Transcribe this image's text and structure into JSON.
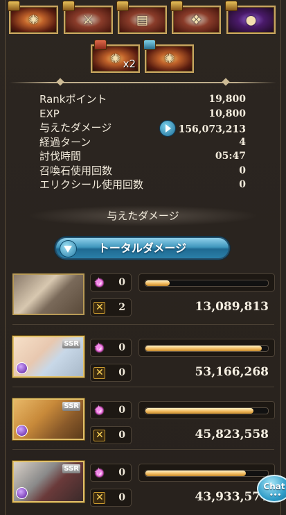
{
  "drops": {
    "row1": [
      {
        "icon": "scroll-icon",
        "count": ""
      },
      {
        "icon": "sword-icon",
        "count": ""
      },
      {
        "icon": "document-icon",
        "count": ""
      },
      {
        "icon": "map-icon",
        "count": ""
      },
      {
        "icon": "orb-icon",
        "count": ""
      }
    ],
    "row2": [
      {
        "icon": "scroll-icon",
        "count": "x2"
      },
      {
        "icon": "scroll-icon",
        "count": ""
      }
    ]
  },
  "stats": {
    "rank_label": "Rankポイント",
    "rank_value": "19,800",
    "exp_label": "EXP",
    "exp_value": "10,800",
    "damage_label": "与えたダメージ",
    "damage_value": "156,073,213",
    "turns_label": "経過ターン",
    "turns_value": "4",
    "time_label": "討伐時間",
    "time_value": "05:47",
    "summon_label": "召喚石使用回数",
    "summon_value": "0",
    "elixir_label": "エリクシール使用回数",
    "elixir_value": "0"
  },
  "section_title": "与えたダメージ",
  "tab_label": "トータルダメージ",
  "members": [
    {
      "ssr": "",
      "ougi": "0",
      "ca": "2",
      "damage": "13,089,813",
      "bar": 0.2
    },
    {
      "ssr": "SSR",
      "ougi": "0",
      "ca": "0",
      "damage": "53,166,268",
      "bar": 0.95
    },
    {
      "ssr": "SSR",
      "ougi": "0",
      "ca": "0",
      "damage": "45,823,558",
      "bar": 0.88
    },
    {
      "ssr": "SSR",
      "ougi": "0",
      "ca": "0",
      "damage": "43,933,574",
      "bar": 0.82
    }
  ],
  "chat_label": "Chat",
  "colors": {
    "accent": "#3f97bd",
    "gold": "#c8a560",
    "bar_fill": "#f0b75a"
  }
}
